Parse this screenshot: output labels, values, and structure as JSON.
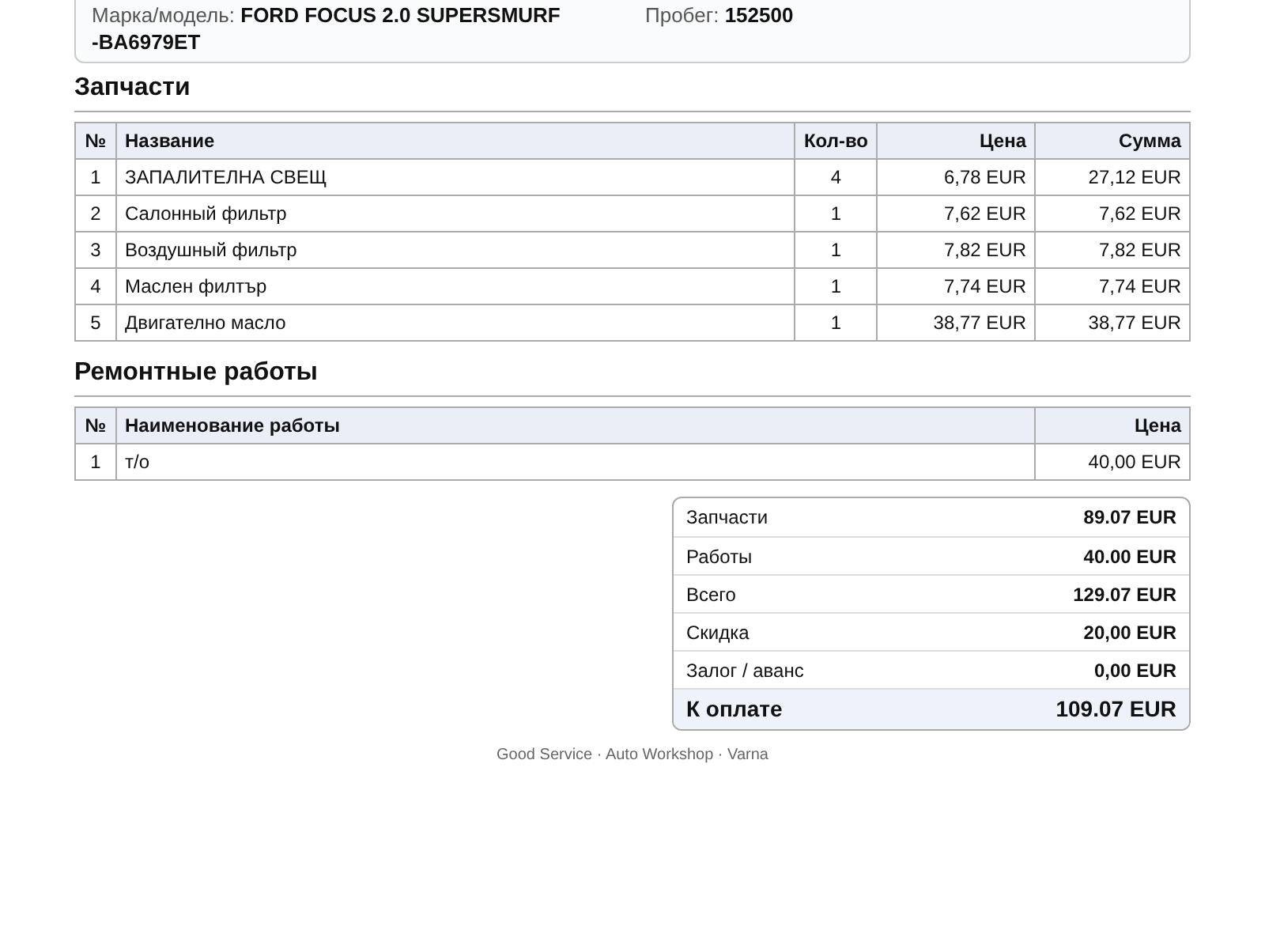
{
  "vehicle": {
    "model_label": "Марка/модель:",
    "model_value": "FORD FOCUS 2.0 SUPERSMURF",
    "model_value_cont": "-BA6979ET",
    "mileage_label": "Пробег:",
    "mileage_value": "152500"
  },
  "parts": {
    "title": "Запчасти",
    "columns": [
      "№",
      "Название",
      "Кол-во",
      "Цена",
      "Сумма"
    ],
    "rows": [
      [
        "1",
        "ЗАПАЛИТЕЛНА СВЕЩ",
        "4",
        "6,78 EUR",
        "27,12 EUR"
      ],
      [
        "2",
        "Салонный фильтр",
        "1",
        "7,62 EUR",
        "7,62 EUR"
      ],
      [
        "3",
        "Воздушный фильтр",
        "1",
        "7,82 EUR",
        "7,82 EUR"
      ],
      [
        "4",
        "Маслен филтър",
        "1",
        "7,74 EUR",
        "7,74 EUR"
      ],
      [
        "5",
        "Двигателно масло",
        "1",
        "38,77 EUR",
        "38,77 EUR"
      ]
    ]
  },
  "works": {
    "title": "Ремонтные работы",
    "columns": [
      "№",
      "Наименование работы",
      "Цена"
    ],
    "rows": [
      [
        "1",
        "т/о",
        "40,00 EUR"
      ]
    ]
  },
  "totals": [
    {
      "label": "Запчасти",
      "value": "89.07 EUR",
      "kind": "line"
    },
    {
      "label": "Работы",
      "value": "40.00 EUR",
      "kind": "line"
    },
    {
      "label": "Всего",
      "value": "129.07 EUR",
      "kind": "line"
    },
    {
      "label": "Скидка",
      "value": "20,00 EUR",
      "kind": "line"
    },
    {
      "label": "Залог / аванс",
      "value": "0,00 EUR",
      "kind": "line"
    },
    {
      "label": "К оплате",
      "value": "109.07 EUR",
      "kind": "grand"
    }
  ],
  "footer": "Good Service · Auto Workshop · Varna"
}
